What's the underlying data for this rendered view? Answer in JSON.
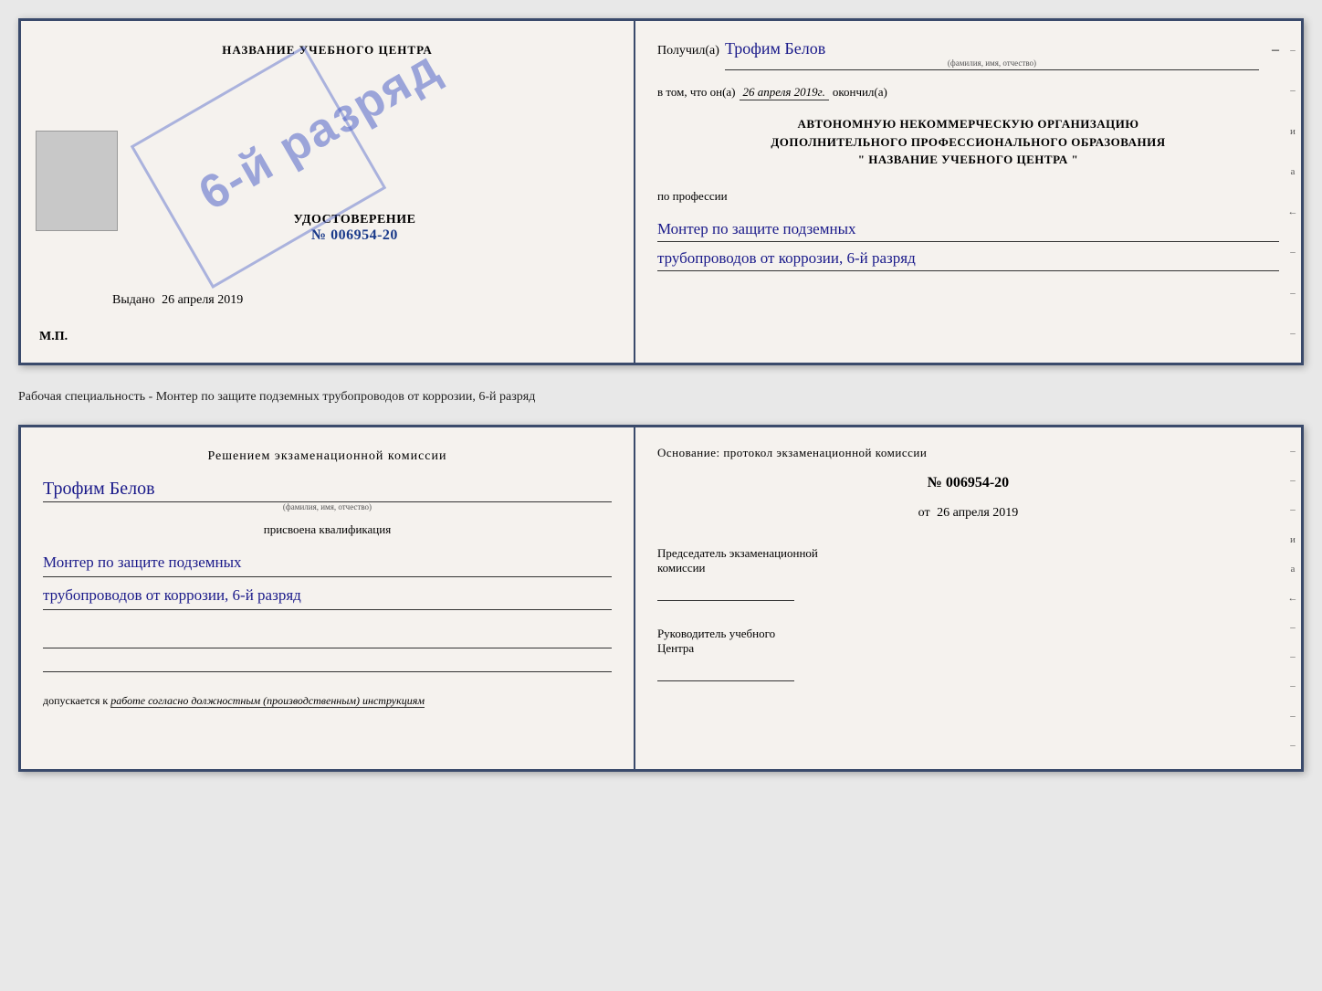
{
  "top_doc": {
    "left": {
      "title": "НАЗВАНИЕ УЧЕБНОГО ЦЕНТРА",
      "stamp_text": "6-й разряд",
      "udost_label": "УДОСТОВЕРЕНИЕ",
      "udost_num": "№ 006954-20",
      "vydano_label": "Выдано",
      "vydano_date": "26 апреля 2019",
      "mp_label": "М.П."
    },
    "right": {
      "poluchil_label": "Получил(а)",
      "poluchil_name": "Трофим Белов",
      "fio_caption": "(фамилия, имя, отчество)",
      "dash": "–",
      "vtom_label": "в том, что он(а)",
      "date_value": "26 апреля 2019г.",
      "okonchil_label": "окончил(а)",
      "org_line1": "АВТОНОМНУЮ НЕКОММЕРЧЕСКУЮ ОРГАНИЗАЦИЮ",
      "org_line2": "ДОПОЛНИТЕЛЬНОГО ПРОФЕССИОНАЛЬНОГО ОБРАЗОВАНИЯ",
      "org_line3": "\"   НАЗВАНИЕ УЧЕБНОГО ЦЕНТРА   \"",
      "po_professii": "по профессии",
      "profession_line1": "Монтер по защите подземных",
      "profession_line2": "трубопроводов от коррозии, 6-й разряд"
    }
  },
  "separator": {
    "text": "Рабочая специальность - Монтер по защите подземных трубопроводов от коррозии, 6-й разряд"
  },
  "bottom_doc": {
    "left": {
      "resheniem_label": "Решением экзаменационной комиссии",
      "name": "Трофим Белов",
      "fio_caption": "(фамилия, имя, отчество)",
      "prisvoyena_label": "присвоена квалификация",
      "qualification_line1": "Монтер по защите подземных",
      "qualification_line2": "трубопроводов от коррозии, 6-й разряд",
      "dopuskaetsya_label": "допускается к",
      "dopuskaetsya_value": "работе согласно должностным (производственным) инструкциям"
    },
    "right": {
      "osnovanie_label": "Основание: протокол экзаменационной комиссии",
      "protocol_num": "№  006954-20",
      "ot_prefix": "от",
      "ot_date": "26 апреля 2019",
      "chairman_line1": "Председатель экзаменационной",
      "chairman_line2": "комиссии",
      "rukovoditel_line1": "Руководитель учебного",
      "rukovoditel_line2": "Центра"
    }
  },
  "sidebar_dashes": [
    "-",
    "-",
    "и",
    "а",
    "←",
    "-",
    "-",
    "-",
    "-"
  ],
  "sidebar_dashes2": [
    "-",
    "-",
    "-",
    "и",
    "а",
    "←",
    "-",
    "-",
    "-",
    "-",
    "-"
  ]
}
